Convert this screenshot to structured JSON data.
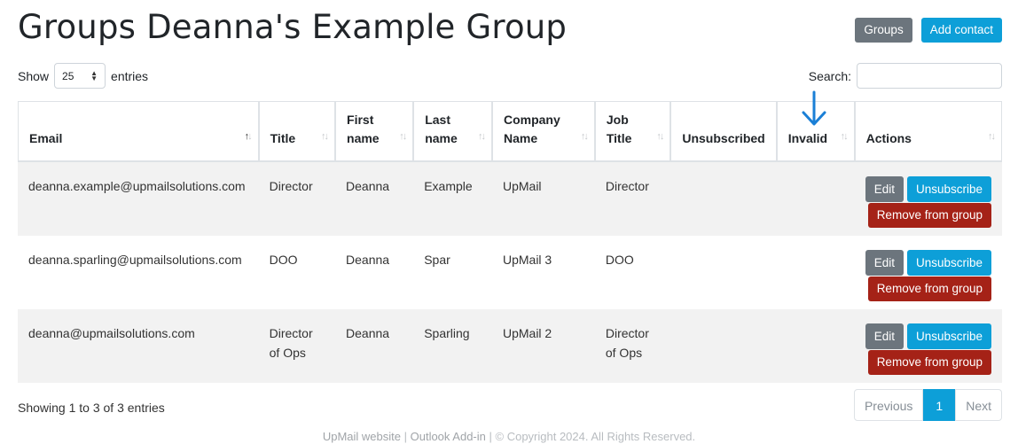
{
  "header": {
    "title": "Groups Deanna's Example Group",
    "groups_label": "Groups",
    "add_contact_label": "Add contact"
  },
  "length_menu": {
    "show_label": "Show",
    "value": "25",
    "entries_label": "entries"
  },
  "search": {
    "label": "Search:",
    "value": ""
  },
  "table": {
    "columns": [
      {
        "line1": "Email",
        "line2": ""
      },
      {
        "line1": "Title",
        "line2": ""
      },
      {
        "line1": "First",
        "line2": "name"
      },
      {
        "line1": "Last",
        "line2": "name"
      },
      {
        "line1": "Company",
        "line2": "Name"
      },
      {
        "line1": "Job",
        "line2": "Title"
      },
      {
        "line1": "Unsubscribed",
        "line2": ""
      },
      {
        "line1": "Invalid",
        "line2": ""
      },
      {
        "line1": "Actions",
        "line2": ""
      }
    ],
    "rows": [
      {
        "email": "deanna.example@upmailsolutions.com",
        "title": [
          "Director",
          ""
        ],
        "first_name": "Deanna",
        "last_name": "Example",
        "company": "UpMail",
        "job_title": [
          "Director",
          ""
        ],
        "unsubscribed": "",
        "invalid": ""
      },
      {
        "email": "deanna.sparling@upmailsolutions.com",
        "title": [
          "DOO",
          ""
        ],
        "first_name": "Deanna",
        "last_name": "Spar",
        "company": "UpMail 3",
        "job_title": [
          "DOO",
          ""
        ],
        "unsubscribed": "",
        "invalid": ""
      },
      {
        "email": "deanna@upmailsolutions.com",
        "title": [
          "Director",
          "of Ops"
        ],
        "first_name": "Deanna",
        "last_name": "Sparling",
        "company": "UpMail 2",
        "job_title": [
          "Director",
          "of Ops"
        ],
        "unsubscribed": "",
        "invalid": ""
      }
    ],
    "actions": {
      "edit_label": "Edit",
      "unsubscribe_label": "Unsubscribe",
      "remove_label": "Remove from group"
    },
    "sort_icon": "sort-arrows-icon"
  },
  "info": "Showing 1 to 3 of 3 entries",
  "pagination": {
    "previous": "Previous",
    "current": "1",
    "next": "Next"
  },
  "footer": {
    "website": "UpMail website",
    "addin": "Outlook Add-in",
    "copyright": "© Copyright 2024. All Rights Reserved."
  },
  "colors": {
    "primary": "#0d9fd8",
    "secondary": "#6c757d",
    "danger": "#a52217",
    "annotation_arrow": "#1a7fd6"
  },
  "annotation": {
    "icon": "arrow-down-icon"
  }
}
